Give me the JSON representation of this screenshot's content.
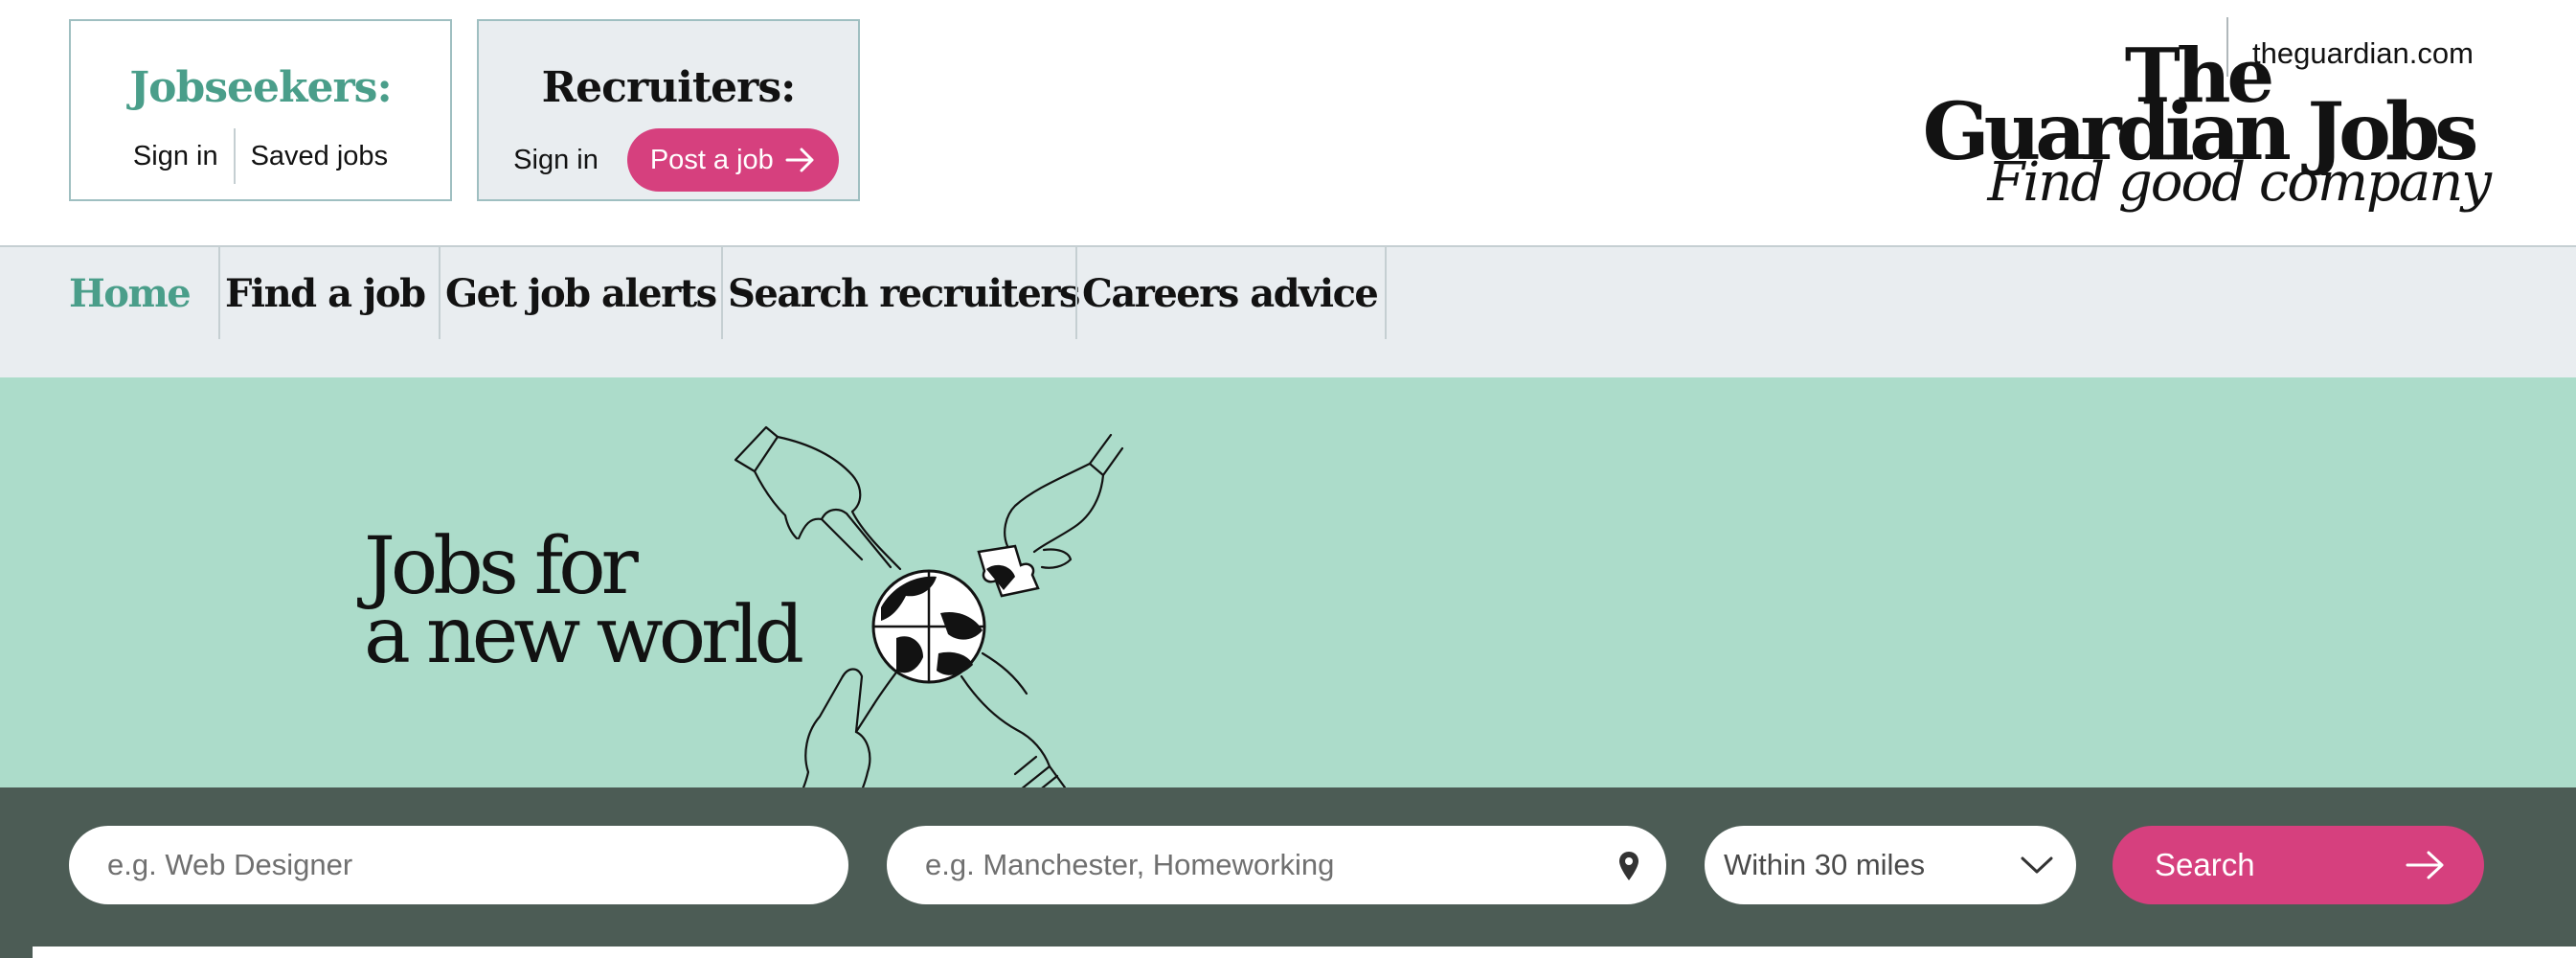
{
  "jobseekers": {
    "title": "Jobseekers:",
    "sign_in": "Sign in",
    "saved_jobs": "Saved jobs"
  },
  "recruiters": {
    "title": "Recruiters:",
    "sign_in": "Sign in",
    "post_job": "Post a job"
  },
  "site_link": "theguardian.com",
  "logo": {
    "line1": "The",
    "line2": "Guardian Jobs",
    "tagline": "Find good company"
  },
  "nav": {
    "items": [
      {
        "label": "Home",
        "active": true
      },
      {
        "label": "Find a job",
        "active": false
      },
      {
        "label": "Get job alerts",
        "active": false
      },
      {
        "label": "Search recruiters",
        "active": false
      },
      {
        "label": "Careers advice",
        "active": false
      }
    ]
  },
  "hero": {
    "line1": "Jobs for",
    "line2": "a new world"
  },
  "search": {
    "keyword_placeholder": "e.g. Web Designer",
    "location_placeholder": "e.g. Manchester, Homeworking",
    "radius_value": "Within 30 miles",
    "button_label": "Search",
    "location_icon": "location-pin-icon",
    "radius_icon": "chevron-down-icon",
    "button_icon": "arrow-right-icon"
  },
  "colors": {
    "brand_teal": "#4a9e8a",
    "accent_pink": "#d6407e",
    "hero_bg": "#acdcca",
    "search_bg": "#4c5c55",
    "nav_bg": "#e9edf0"
  }
}
